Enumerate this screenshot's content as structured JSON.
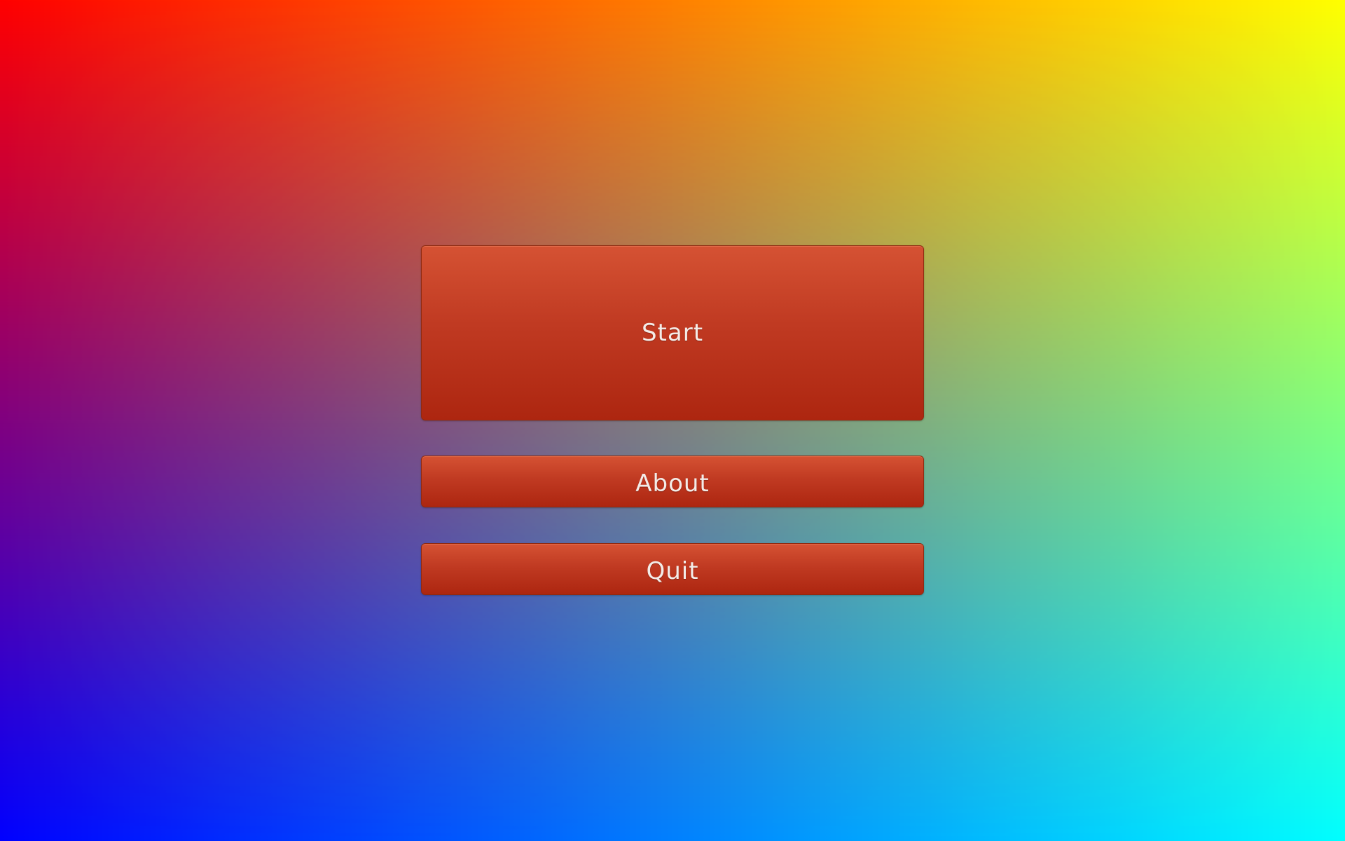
{
  "colors": {
    "background_top_left": "#ff0000",
    "background_top_right": "#ffff00",
    "background_bottom_left": "#0000ff",
    "background_bottom_right": "#00ffff",
    "button_fill": "#c03a22",
    "button_text": "#f3ece8"
  },
  "main_menu": {
    "buttons": [
      {
        "label": "Start"
      },
      {
        "label": "About"
      },
      {
        "label": "Quit"
      }
    ]
  }
}
